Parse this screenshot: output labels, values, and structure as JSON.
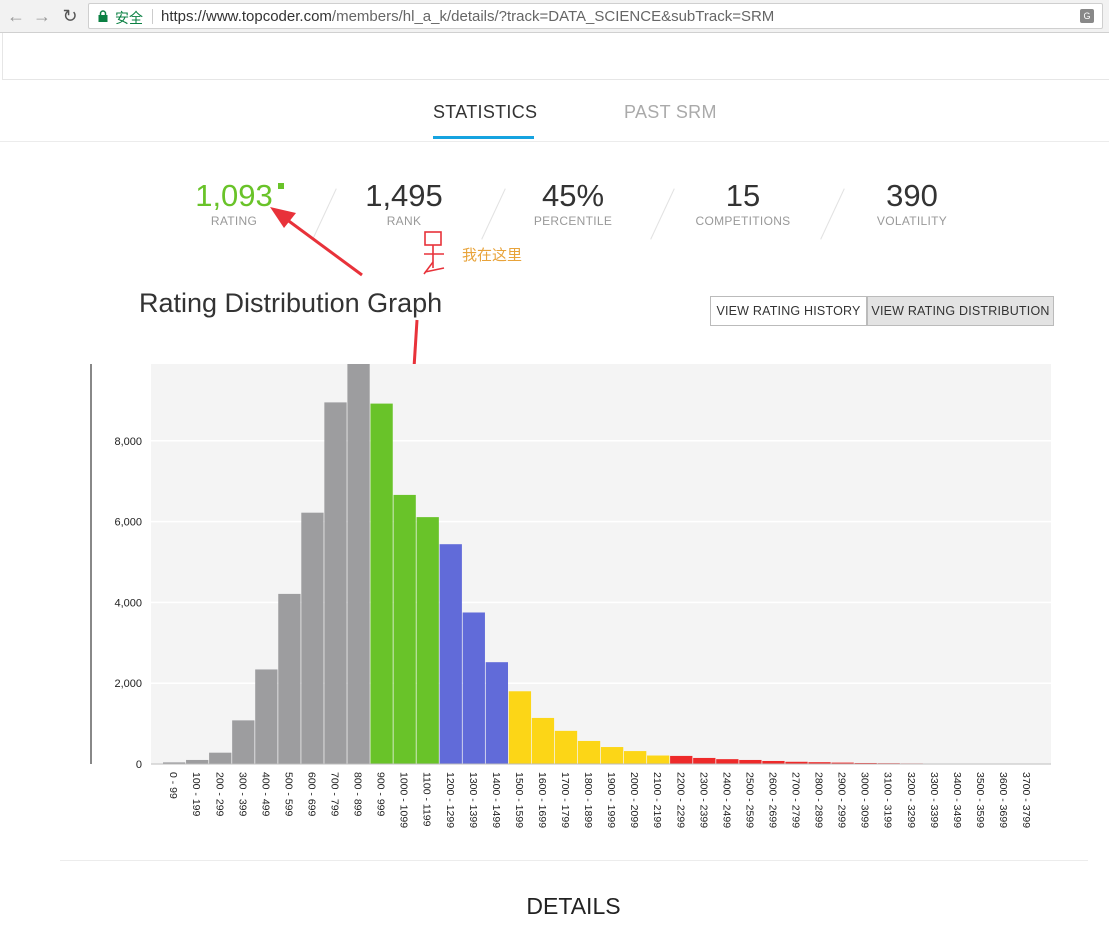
{
  "browser": {
    "secure_label": "安全",
    "url_scheme_host": "https://www.topcoder.com",
    "url_path": "/members/hl_a_k/details/?track=DATA_SCIENCE&subTrack=SRM"
  },
  "tabs": [
    {
      "label": "STATISTICS",
      "active": true
    },
    {
      "label": "PAST SRM",
      "active": false
    }
  ],
  "stats": {
    "rating": {
      "value": "1,093",
      "label": "RATING"
    },
    "rank": {
      "value": "1,495",
      "label": "RANK"
    },
    "percentile": {
      "value": "45%",
      "label": "PERCENTILE"
    },
    "competitions": {
      "value": "15",
      "label": "COMPETITIONS"
    },
    "volatility": {
      "value": "390",
      "label": "VOLATILITY"
    }
  },
  "annotation": {
    "text": "我在这里"
  },
  "graph": {
    "title": "Rating Distribution Graph",
    "btn_history": "VIEW RATING HISTORY",
    "btn_distribution": "VIEW RATING DISTRIBUTION"
  },
  "details_heading": "DETAILS",
  "colors": {
    "gray": "#9d9d9f",
    "green": "#69c329",
    "blue": "#616bd9",
    "yellow": "#fcd617",
    "red": "#ee2a2a",
    "accent": "#16a3e0"
  },
  "chart_data": {
    "type": "bar",
    "categories": [
      "0 - 99",
      "100 - 199",
      "200 - 299",
      "300 - 399",
      "400 - 499",
      "500 - 599",
      "600 - 699",
      "700 - 799",
      "800 - 899",
      "900 - 999",
      "1000 - 1099",
      "1100 - 1199",
      "1200 - 1299",
      "1300 - 1399",
      "1400 - 1499",
      "1500 - 1599",
      "1600 - 1699",
      "1700 - 1799",
      "1800 - 1899",
      "1900 - 1999",
      "2000 - 2099",
      "2100 - 2199",
      "2200 - 2299",
      "2300 - 2399",
      "2400 - 2499",
      "2500 - 2599",
      "2600 - 2699",
      "2700 - 2799",
      "2800 - 2899",
      "2900 - 2999",
      "3000 - 3099",
      "3100 - 3199",
      "3200 - 3299",
      "3300 - 3399",
      "3400 - 3499",
      "3500 - 3599",
      "3600 - 3699",
      "3700 - 3799"
    ],
    "values": [
      40,
      100,
      280,
      1080,
      2340,
      4210,
      6220,
      8950,
      9900,
      8920,
      6660,
      6110,
      5440,
      3750,
      2520,
      1800,
      1140,
      820,
      570,
      420,
      320,
      210,
      200,
      150,
      120,
      100,
      75,
      55,
      45,
      35,
      25,
      20,
      15,
      12,
      10,
      8,
      6,
      5
    ],
    "bar_colors": [
      "gray",
      "gray",
      "gray",
      "gray",
      "gray",
      "gray",
      "gray",
      "gray",
      "gray",
      "green",
      "green",
      "green",
      "blue",
      "blue",
      "blue",
      "yellow",
      "yellow",
      "yellow",
      "yellow",
      "yellow",
      "yellow",
      "yellow",
      "red",
      "red",
      "red",
      "red",
      "red",
      "red",
      "red",
      "red",
      "red",
      "red",
      "red",
      "red",
      "red",
      "red",
      "red",
      "red"
    ],
    "y_ticks": [
      0,
      2000,
      4000,
      6000,
      8000
    ],
    "y_tick_labels": [
      "0",
      "2,000",
      "4,000",
      "6,000",
      "8,000"
    ],
    "ylim": [
      0,
      9900
    ],
    "grid": true
  }
}
